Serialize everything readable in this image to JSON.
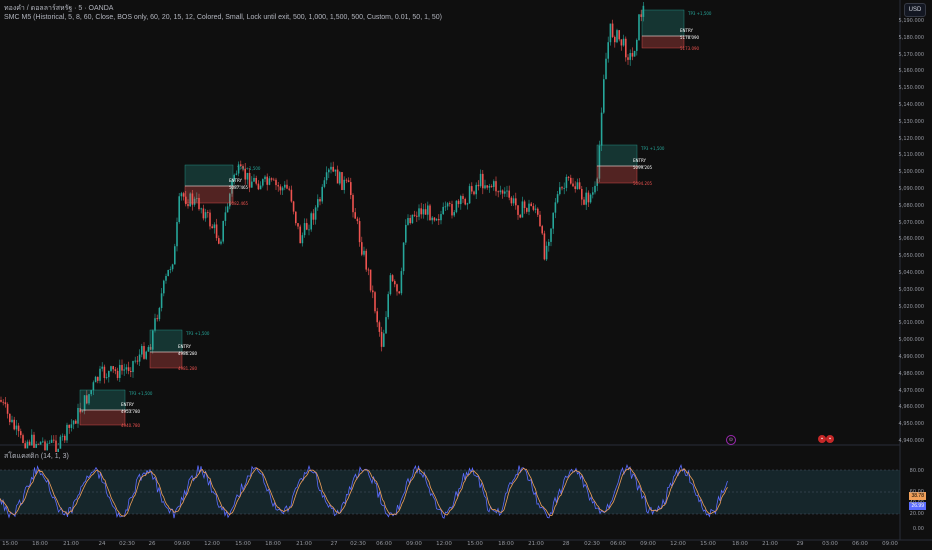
{
  "header": {
    "title": "ทองคำ / ดอลลาร์สหรัฐ · 5 · OANDA",
    "indicator": "SMC M5  (Historical, 5, 8, 60, Close, BOS only, 60, 20, 15, 12, Colored, Small, Lock until exit, 500, 1,000, 1,500, 500, Custom, 0.01, 50, 1, 50)"
  },
  "currency_button": "USD",
  "price_axis": [
    "5,190.000",
    "5,180.000",
    "5,170.000",
    "5,160.000",
    "5,150.000",
    "5,140.000",
    "5,130.000",
    "5,120.000",
    "5,110.000",
    "5,100.000",
    "5,090.000",
    "5,080.000",
    "5,070.000",
    "5,060.000",
    "5,050.000",
    "5,040.000",
    "5,030.000",
    "5,020.000",
    "5,010.000",
    "5,000.000",
    "4,990.000",
    "4,980.000",
    "4,970.000",
    "4,960.000",
    "4,950.000",
    "4,940.000"
  ],
  "oscillator": {
    "title": "สโตแคสติก (14, 1, 3)",
    "axis": [
      "80.00",
      "60.00",
      "40.00",
      "20.00",
      "0.00"
    ],
    "value_k": "38.78",
    "value_d": "26.99"
  },
  "time_axis": [
    "15:00",
    "18:00",
    "21:00",
    "24",
    "02:30",
    "26",
    "09:00",
    "12:00",
    "15:00",
    "18:00",
    "21:00",
    "27",
    "02:30",
    "06:00",
    "09:00",
    "12:00",
    "15:00",
    "18:00",
    "21:00",
    "28",
    "02:30",
    "06:00",
    "09:00",
    "12:00",
    "15:00",
    "18:00",
    "21:00",
    "29",
    "03:00",
    "06:00",
    "09:00"
  ],
  "trade_boxes": [
    {
      "tp": "TP3 +1,500",
      "entry_label": "ENTRY",
      "entry": "4953.780",
      "sl": "4940.780"
    },
    {
      "tp": "TP3 +1,500",
      "entry_label": "ENTRY",
      "entry": "4986.280",
      "sl": "4981.280"
    },
    {
      "tp": "TP3 +1,500",
      "entry_label": "ENTRY",
      "entry": "5087.465",
      "sl": "5082.465"
    },
    {
      "tp": "TP3 +1,500",
      "entry_label": "ENTRY",
      "entry": "5099.205",
      "sl": "5094.205"
    },
    {
      "tp": "TP3 +1,500",
      "entry_label": "ENTRY",
      "entry": "5178.090",
      "sl": "5173.090"
    }
  ],
  "colors": {
    "bull": "#26a69a",
    "bear": "#ef5350",
    "k": "#5b6cff",
    "d": "#f0a05a",
    "band": "#1d3a44"
  }
}
